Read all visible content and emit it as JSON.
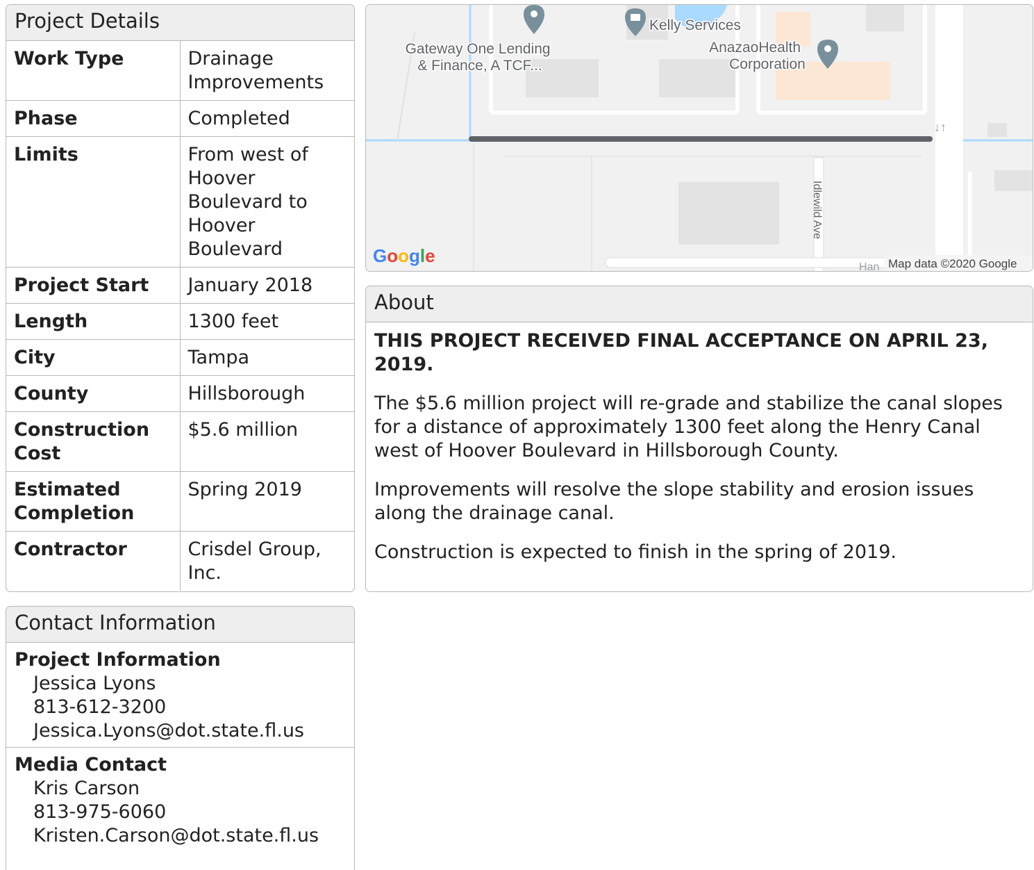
{
  "details": {
    "title": "Project Details",
    "rows": [
      {
        "label": "Work Type",
        "value": "Drainage Improvements"
      },
      {
        "label": "Phase",
        "value": "Completed"
      },
      {
        "label": "Limits",
        "value": "From west of Hoover Boulevard to Hoover Boulevard"
      },
      {
        "label": "Project Start",
        "value": "January 2018"
      },
      {
        "label": "Length",
        "value": "1300 feet"
      },
      {
        "label": "City",
        "value": "Tampa"
      },
      {
        "label": "County",
        "value": "Hillsborough"
      },
      {
        "label": "Construction Cost",
        "value": "$5.6 million"
      },
      {
        "label": "Estimated Completion",
        "value": "Spring 2019"
      },
      {
        "label": "Contractor",
        "value": "Crisdel Group, Inc."
      }
    ]
  },
  "map": {
    "places": [
      {
        "name": "Gateway One Lending & Finance, A TCF..."
      },
      {
        "name": "Kelly Services"
      },
      {
        "name": "AnazaoHealth Corporation"
      }
    ],
    "street_label": "Idlewild Ave",
    "partial_label": "Han",
    "logo_text": "Google",
    "attribution": "Map data ©2020 Google",
    "colors": {
      "road": "#ffffff",
      "water": "#aadaff",
      "building": "#e5e5e5",
      "route": "#5f6368",
      "pin": "#78909c"
    }
  },
  "about": {
    "title": "About",
    "announcement": "THIS PROJECT RECEIVED FINAL ACCEPTANCE ON APRIL 23, 2019.",
    "paragraphs": [
      "The $5.6 million project will re-grade and stabilize the canal slopes for a distance of approximately 1300 feet along the Henry Canal west of Hoover Boulevard in Hillsborough County.",
      "Improvements will resolve the slope stability and erosion issues along the drainage canal.",
      "Construction is expected to finish in the spring of 2019."
    ]
  },
  "contact": {
    "title": "Contact Information",
    "blocks": [
      {
        "heading": "Project Information",
        "name": "Jessica Lyons",
        "phone": "813-612-3200",
        "email": "Jessica.Lyons@dot.state.fl.us"
      },
      {
        "heading": "Media Contact",
        "name": "Kris Carson",
        "phone": "813-975-6060",
        "email": "Kristen.Carson@dot.state.fl.us"
      }
    ]
  }
}
